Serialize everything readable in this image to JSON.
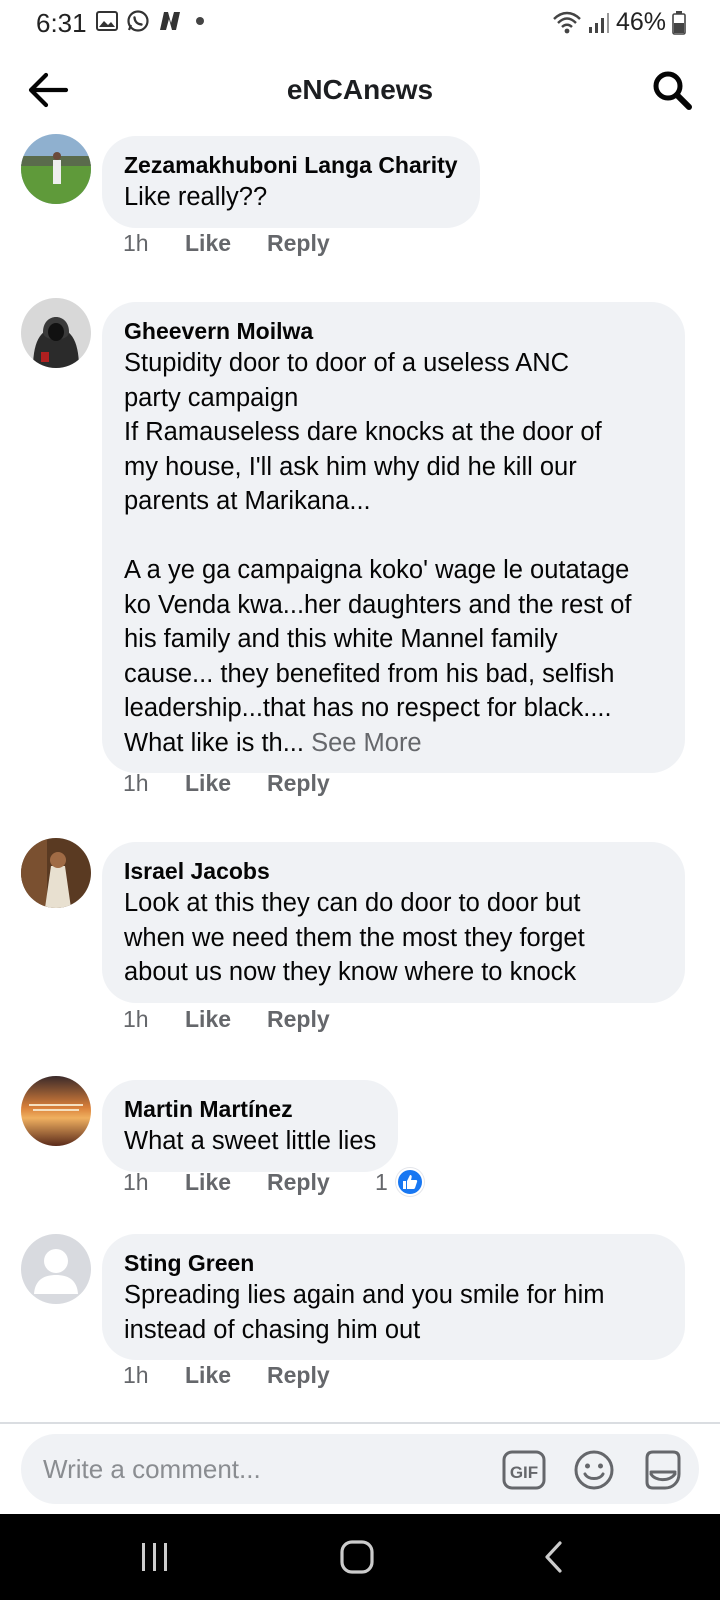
{
  "status_bar": {
    "time": "6:31",
    "battery": "46%"
  },
  "header": {
    "title": "eNCAnews"
  },
  "comments": [
    {
      "author": "Zezamakhuboni Langa Charity",
      "text": "Like really??",
      "time": "1h",
      "like_label": "Like",
      "reply_label": "Reply"
    },
    {
      "author": "Gheevern Moilwa",
      "text": "Stupidity door to door of a useless ANC\nparty campaign\nIf Ramauseless dare knocks at the door of\nmy house, I'll ask him why did he kill our\nparents at Marikana...\n\nA a ye ga campaigna koko' wage le outatage\nko Venda kwa...her daughters and the rest of\nhis family and this white Mannel family\ncause... they benefited from his bad, selfish\nleadership...that has no respect for black....\nWhat like is th... ",
      "see_more": "See More",
      "time": "1h",
      "like_label": "Like",
      "reply_label": "Reply"
    },
    {
      "author": "Israel Jacobs",
      "text": "Look at this they can do door to door but\nwhen we need them the most they forget\nabout us now they know where to knock",
      "time": "1h",
      "like_label": "Like",
      "reply_label": "Reply"
    },
    {
      "author": "Martin Martínez",
      "text": "What a sweet little lies",
      "time": "1h",
      "like_label": "Like",
      "reply_label": "Reply",
      "reaction_count": "1"
    },
    {
      "author": "Sting Green",
      "text": "Spreading lies again and you smile for him\ninstead of chasing him out",
      "time": "1h",
      "like_label": "Like",
      "reply_label": "Reply"
    }
  ],
  "composer": {
    "placeholder": "Write a comment...",
    "gif_label": "GIF"
  },
  "colors": {
    "bubble_bg": "#f0f2f5",
    "secondary_text": "#65676b",
    "like_blue": "#1877f2"
  },
  "icons": [
    "back-arrow-icon",
    "search-icon",
    "gif-icon",
    "emoji-icon",
    "sticker-icon",
    "like-reaction-icon",
    "recents-icon",
    "home-icon",
    "back-nav-icon"
  ]
}
